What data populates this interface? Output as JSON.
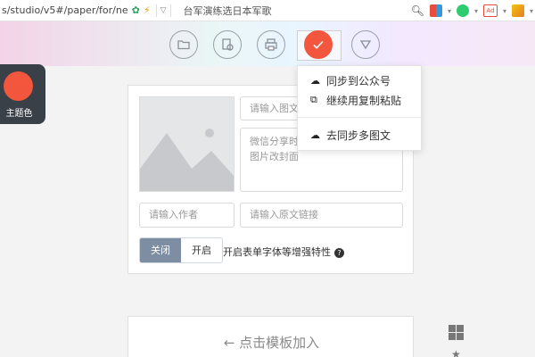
{
  "browser": {
    "url": "s/studio/v5#/paper/for/ne",
    "search_text": "台军演练选日本军歌",
    "icons": [
      "security-shield-icon",
      "lightning-icon",
      "search-icon",
      "app-grid-icon",
      "translate-icon",
      "adblock-icon",
      "screenshot-icon"
    ]
  },
  "theme": {
    "label": "主题色",
    "color": "#f2573d"
  },
  "toolbar": {
    "icons": [
      "folder-icon",
      "template-library-icon",
      "print-icon",
      "check-icon",
      "triangle-down-icon"
    ],
    "active_color": "#f2573d"
  },
  "dropdown": {
    "items": [
      {
        "icon": "cloud-upload-icon",
        "label": "同步到公众号"
      },
      {
        "icon": "external-link-icon",
        "label": "继续用复制粘贴"
      },
      {
        "icon": "cloud-upload-icon",
        "label": "去同步多图文"
      }
    ]
  },
  "editor": {
    "title_placeholder": "请输入图文",
    "summary_placeholder_line1": "微信分享时",
    "summary_placeholder_line2": "图片改封面",
    "author_placeholder": "请输入作者",
    "link_placeholder": "请输入原文链接",
    "toggle_off": "关闭",
    "toggle_on": "开启",
    "enhance_label": "开启表单字体等增强特性",
    "help": "?"
  },
  "template": {
    "label": "← 点击模板加入"
  }
}
